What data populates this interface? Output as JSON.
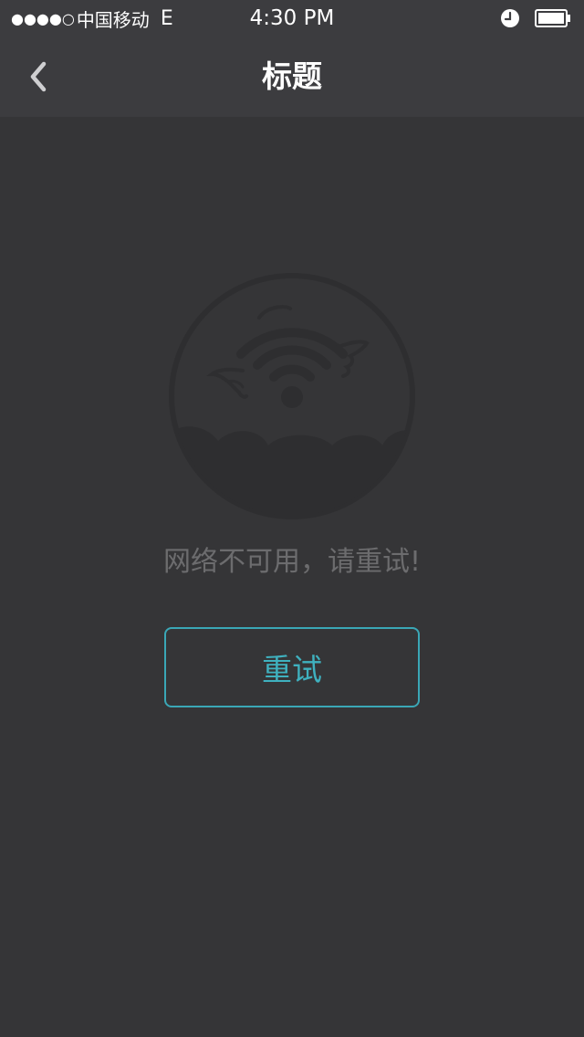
{
  "status_bar": {
    "signal_dots": "●●●●○",
    "carrier": "中国移动",
    "network": "E",
    "time": "4:30 PM",
    "icons": [
      "alarm-icon",
      "battery-icon"
    ]
  },
  "nav": {
    "title": "标题",
    "back_icon": "chevron-left-icon"
  },
  "content": {
    "illustration_icon": "no-network-wifi-icon",
    "message": "网络不可用，请重试!",
    "retry_label": "重试"
  },
  "colors": {
    "background": "#353537",
    "bar_background": "#3c3c3f",
    "accent": "#3aa7b6",
    "message_text": "#6c6c6e",
    "illustration": "#2e2e30"
  }
}
